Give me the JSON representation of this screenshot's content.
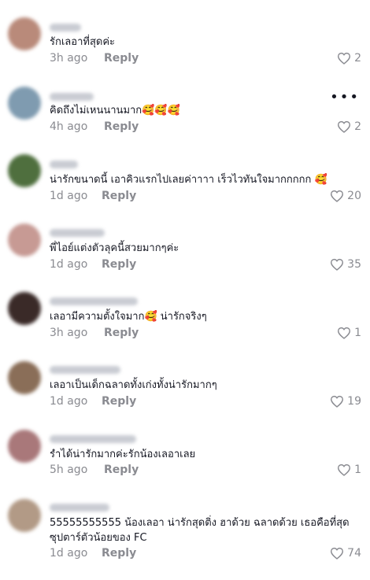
{
  "comments": [
    {
      "text": "รักเลอาที่สุดค่ะ",
      "time": "3h ago",
      "reply": "Reply",
      "likes": "2",
      "avatar_color": "#b98a7a"
    },
    {
      "text": "คิดถึงไม่เหนนานมาก🥰🥰🥰",
      "time": "4h ago",
      "reply": "Reply",
      "likes": "2",
      "avatar_color": "#7f9bb0"
    },
    {
      "text": "น่ารักขนาดนี้ เอาคิวแรกไปเลยค่าาาา เร็วไวทันใจมากกกกก 🥰",
      "time": "1d ago",
      "reply": "Reply",
      "likes": "20",
      "avatar_color": "#4f6f3e"
    },
    {
      "text": "พี่ไอย์แต่งตัวลุคนี้สวยมากๆค่ะ",
      "time": "1d ago",
      "reply": "Reply",
      "likes": "35",
      "avatar_color": "#c79a94"
    },
    {
      "text": "เลอามีความตั้งใจมาก🥰 น่ารักจริงๆ",
      "time": "3h ago",
      "reply": "Reply",
      "likes": "1",
      "avatar_color": "#3a2a28"
    },
    {
      "text": "เลอาเป็นเด็กฉลาดทั้งเก่งทั้งน่ารักมากๆ",
      "time": "1d ago",
      "reply": "Reply",
      "likes": "19",
      "avatar_color": "#8a6e58"
    },
    {
      "text": "รำได้น่ารักมากค่ะรักน้องเลอาเลย",
      "time": "5h ago",
      "reply": "Reply",
      "likes": "1",
      "avatar_color": "#a9787a"
    },
    {
      "text": "55555555555 น้องเลอา น่ารักสุดติ่ง ฮาด้วย ฉลาดด้วย เธอคือที่สุด ซุปตาร์ตัวน้อยของ FC",
      "time": "1d ago",
      "reply": "Reply",
      "likes": "74",
      "avatar_color": "#b29a86"
    }
  ],
  "more_icon": "more-horizontal-icon",
  "like_icon": "heart-outline-icon",
  "colors": {
    "text": "#161823",
    "meta": "#8a8b91",
    "username_blur": "#c9ccd3"
  }
}
